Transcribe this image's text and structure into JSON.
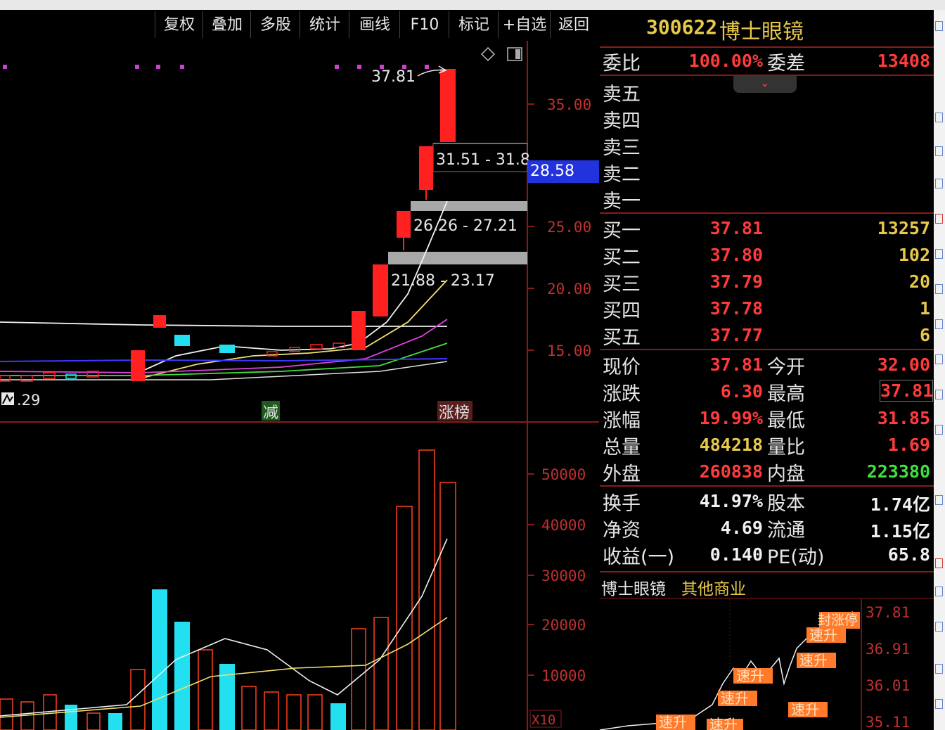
{
  "toolbar": {
    "buttons": [
      "复权",
      "叠加",
      "多股",
      "统计",
      "画线",
      "F10",
      "标记",
      "+自选",
      "返回"
    ]
  },
  "kline": {
    "high_label": "37.81",
    "zones": [
      "31.51 - 31.8",
      "26.26 - 27.21",
      "21.88 - 23.17"
    ],
    "price_ticks": [
      "35.00",
      "25.00",
      "20.00",
      "15.00"
    ],
    "current_tag": "28.58",
    "low_label": ".29",
    "markers": [
      "减",
      "涨榜"
    ],
    "volume_ticks": [
      "50000",
      "40000",
      "30000",
      "20000",
      "10000"
    ],
    "volume_unit": "X10"
  },
  "stock": {
    "code": "300622",
    "name": "博士眼镜"
  },
  "order_book": {
    "weibi_label": "委比",
    "weibi_value": "100.00%",
    "weicha_label": "委差",
    "weicha_value": "13408",
    "sell": [
      "卖五",
      "卖四",
      "卖三",
      "卖二",
      "卖一"
    ],
    "buy": [
      {
        "label": "买一",
        "price": "37.81",
        "vol": "13257"
      },
      {
        "label": "买二",
        "price": "37.80",
        "vol": "102"
      },
      {
        "label": "买三",
        "price": "37.79",
        "vol": "20"
      },
      {
        "label": "买四",
        "price": "37.78",
        "vol": "1"
      },
      {
        "label": "买五",
        "price": "37.77",
        "vol": "6"
      }
    ]
  },
  "quote": {
    "rows": [
      {
        "l1": "现价",
        "v1": "37.81",
        "c1": "red",
        "l2": "今开",
        "v2": "32.00",
        "c2": "red"
      },
      {
        "l1": "涨跌",
        "v1": "6.30",
        "c1": "red",
        "l2": "最高",
        "v2": "37.81",
        "c2": "red"
      },
      {
        "l1": "涨幅",
        "v1": "19.99%",
        "c1": "red",
        "l2": "最低",
        "v2": "31.85",
        "c2": "red"
      },
      {
        "l1": "总量",
        "v1": "484218",
        "c1": "yel",
        "l2": "量比",
        "v2": "1.69",
        "c2": "red"
      },
      {
        "l1": "外盘",
        "v1": "260838",
        "c1": "red",
        "l2": "内盘",
        "v2": "223380",
        "c2": "grn"
      }
    ]
  },
  "fundamentals": {
    "rows": [
      {
        "l1": "换手",
        "v1": "41.97%",
        "l2": "股本",
        "v2": "1.74亿"
      },
      {
        "l1": "净资",
        "v1": "4.69",
        "l2": "流通",
        "v2": "1.15亿"
      },
      {
        "l1": "收益(一)",
        "v1": "0.140",
        "l2": "PE(动)",
        "v2": "65.8"
      }
    ]
  },
  "intraday": {
    "name": "博士眼镜",
    "industry": "其他商业",
    "ticks": [
      "37.81",
      "36.91",
      "36.01",
      "35.11"
    ],
    "tag_label": "速升",
    "tag_label2": "封涨停"
  },
  "colors": {
    "up": "#ff2020",
    "down": "#22e0f0",
    "grid": "#8a1a1a",
    "text": "#e6e6e6",
    "current_tag_bg": "#2233dd"
  }
}
